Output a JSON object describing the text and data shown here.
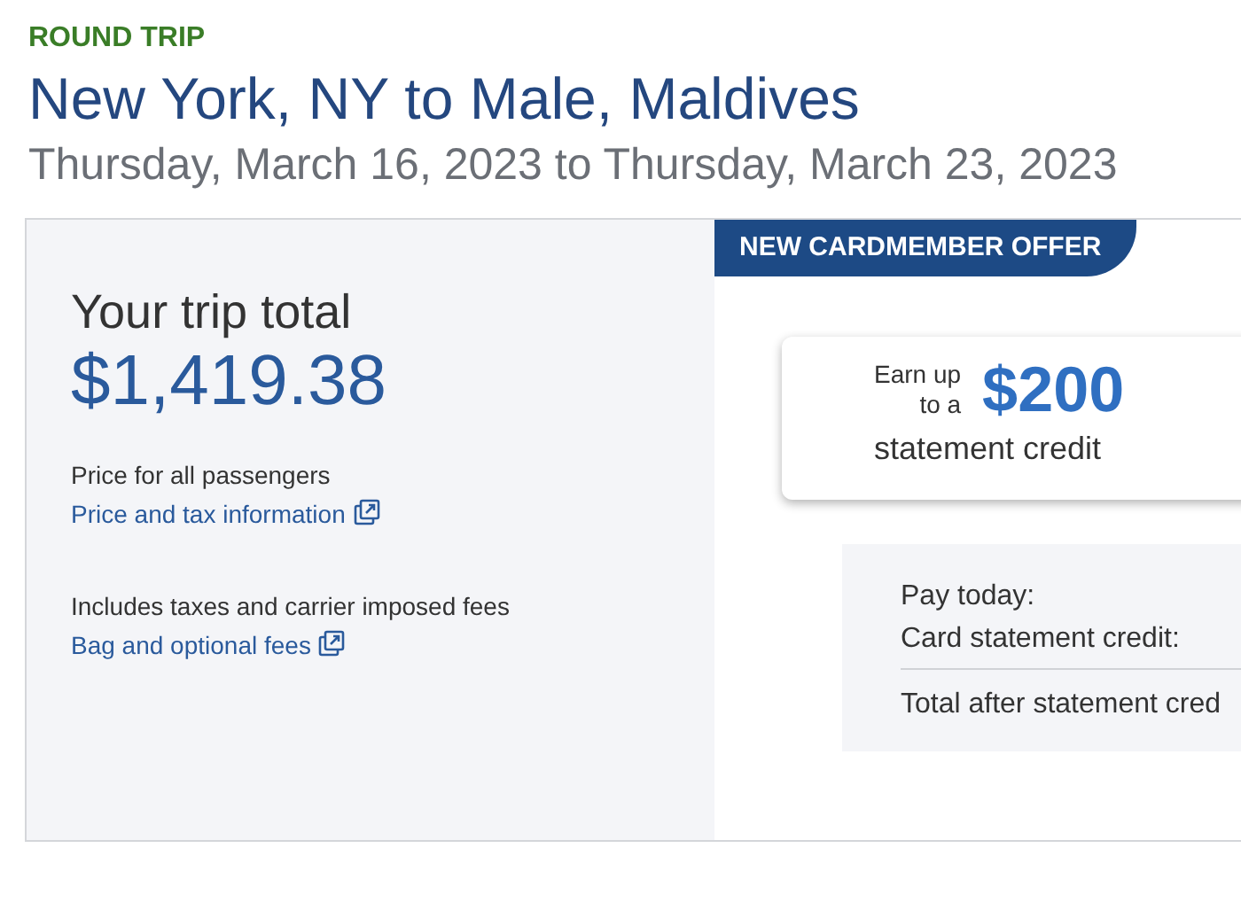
{
  "trip_type": "ROUND TRIP",
  "route": "New York, NY to Male, Maldives",
  "dates": "Thursday, March 16, 2023 to Thursday, March 23, 2023",
  "summary": {
    "heading": "Your trip total",
    "total": "$1,419.38",
    "price_note": "Price for all passengers",
    "price_link": "Price and tax information",
    "fees_note": "Includes taxes and carrier imposed fees",
    "fees_link": "Bag and optional fees"
  },
  "offer": {
    "banner": "NEW CARDMEMBER OFFER",
    "earn_line_1": "Earn up",
    "earn_line_2": "to a",
    "amount": "$200",
    "credit": "statement credit"
  },
  "payment": {
    "rows": [
      "Pay today:",
      "Card statement credit:"
    ],
    "total_label": "Total after statement cred"
  }
}
